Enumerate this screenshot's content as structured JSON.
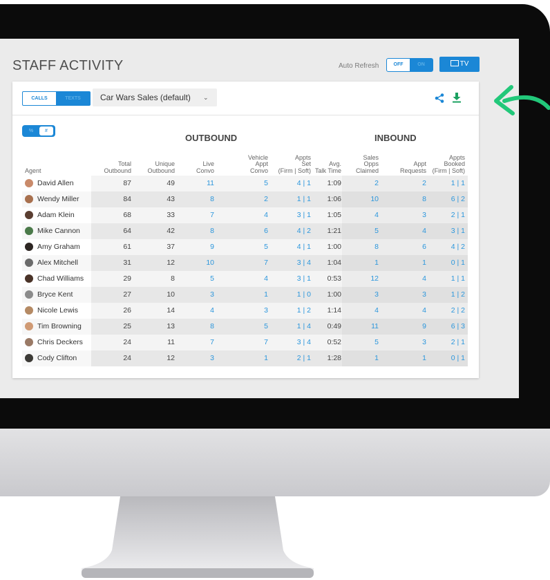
{
  "page": {
    "title": "STAFF ACTIVITY",
    "auto_refresh_label": "Auto Refresh",
    "toggle_off": "OFF",
    "toggle_on": "ON",
    "tv_label": "TV"
  },
  "panel": {
    "tab_calls": "CALLS",
    "tab_texts": "TEXTS",
    "dropdown_value": "Car Wars Sales (default)",
    "pct_label": "%",
    "num_label": "#",
    "outbound_heading": "OUTBOUND",
    "inbound_heading": "INBOUND"
  },
  "columns": {
    "agent": "Agent",
    "total_outbound": [
      "Total",
      "Outbound"
    ],
    "unique_outbound": [
      "Unique",
      "Outbound"
    ],
    "live_convo": [
      "Live",
      "Convo"
    ],
    "vehicle_appt_convo": [
      "Vehicle",
      "Appt",
      "Convo"
    ],
    "appts_set": [
      "Appts",
      "Set",
      "(Firm | Soft)"
    ],
    "avg_talk_time": [
      "Avg.",
      "Talk Time"
    ],
    "sales_opps_claimed": [
      "Sales",
      "Opps",
      "Claimed"
    ],
    "appt_requests": [
      "Appt",
      "Requests"
    ],
    "appts_booked": [
      "Appts",
      "Booked",
      "(Firm | Soft)"
    ]
  },
  "rows": [
    {
      "agent": "David Allen",
      "total": "87",
      "unique": "49",
      "live": "11",
      "vehicle": "5",
      "set": "4 | 1",
      "avg": "1:09",
      "opps": "2",
      "req": "2",
      "booked": "1 | 1"
    },
    {
      "agent": "Wendy Miller",
      "total": "84",
      "unique": "43",
      "live": "8",
      "vehicle": "2",
      "set": "1 | 1",
      "avg": "1:06",
      "opps": "10",
      "req": "8",
      "booked": "6 | 2"
    },
    {
      "agent": "Adam Klein",
      "total": "68",
      "unique": "33",
      "live": "7",
      "vehicle": "4",
      "set": "3 | 1",
      "avg": "1:05",
      "opps": "4",
      "req": "3",
      "booked": "2 | 1"
    },
    {
      "agent": "Mike Cannon",
      "total": "64",
      "unique": "42",
      "live": "8",
      "vehicle": "6",
      "set": "4 | 2",
      "avg": "1:21",
      "opps": "5",
      "req": "4",
      "booked": "3 | 1"
    },
    {
      "agent": "Amy Graham",
      "total": "61",
      "unique": "37",
      "live": "9",
      "vehicle": "5",
      "set": "4 | 1",
      "avg": "1:00",
      "opps": "8",
      "req": "6",
      "booked": "4 | 2"
    },
    {
      "agent": "Alex Mitchell",
      "total": "31",
      "unique": "12",
      "live": "10",
      "vehicle": "7",
      "set": "3 | 4",
      "avg": "1:04",
      "opps": "1",
      "req": "1",
      "booked": "0 | 1"
    },
    {
      "agent": "Chad Williams",
      "total": "29",
      "unique": "8",
      "live": "5",
      "vehicle": "4",
      "set": "3 | 1",
      "avg": "0:53",
      "opps": "12",
      "req": "4",
      "booked": "1 | 1"
    },
    {
      "agent": "Bryce Kent",
      "total": "27",
      "unique": "10",
      "live": "3",
      "vehicle": "1",
      "set": "1 | 0",
      "avg": "1:00",
      "opps": "3",
      "req": "3",
      "booked": "1 | 2"
    },
    {
      "agent": "Nicole Lewis",
      "total": "26",
      "unique": "14",
      "live": "4",
      "vehicle": "3",
      "set": "1 | 2",
      "avg": "1:14",
      "opps": "4",
      "req": "4",
      "booked": "2 | 2"
    },
    {
      "agent": "Tim Browning",
      "total": "25",
      "unique": "13",
      "live": "8",
      "vehicle": "5",
      "set": "1 | 4",
      "avg": "0:49",
      "opps": "11",
      "req": "9",
      "booked": "6 | 3"
    },
    {
      "agent": "Chris Deckers",
      "total": "24",
      "unique": "11",
      "live": "7",
      "vehicle": "7",
      "set": "3 | 4",
      "avg": "0:52",
      "opps": "5",
      "req": "3",
      "booked": "2 | 1"
    },
    {
      "agent": "Cody Clifton",
      "total": "24",
      "unique": "12",
      "live": "3",
      "vehicle": "1",
      "set": "2 | 1",
      "avg": "1:28",
      "opps": "1",
      "req": "1",
      "booked": "0 | 1"
    }
  ],
  "colors": {
    "accent": "#1b87d6",
    "link_value": "#2b96dc",
    "arrow": "#22c87a",
    "download": "#1aa060",
    "bezel": "#0b0b0b"
  },
  "icons": [
    "share-icon",
    "download-icon",
    "tv-icon",
    "chevron-down-icon",
    "arrow-pointer-icon"
  ]
}
